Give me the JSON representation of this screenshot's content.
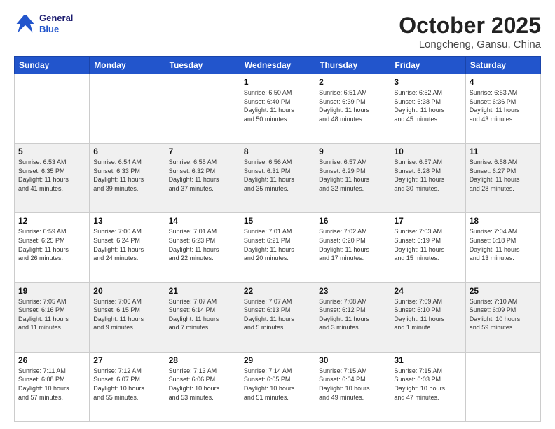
{
  "header": {
    "logo_line1": "General",
    "logo_line2": "Blue",
    "month": "October 2025",
    "location": "Longcheng, Gansu, China"
  },
  "days_of_week": [
    "Sunday",
    "Monday",
    "Tuesday",
    "Wednesday",
    "Thursday",
    "Friday",
    "Saturday"
  ],
  "weeks": [
    [
      {
        "num": "",
        "info": ""
      },
      {
        "num": "",
        "info": ""
      },
      {
        "num": "",
        "info": ""
      },
      {
        "num": "1",
        "info": "Sunrise: 6:50 AM\nSunset: 6:40 PM\nDaylight: 11 hours\nand 50 minutes."
      },
      {
        "num": "2",
        "info": "Sunrise: 6:51 AM\nSunset: 6:39 PM\nDaylight: 11 hours\nand 48 minutes."
      },
      {
        "num": "3",
        "info": "Sunrise: 6:52 AM\nSunset: 6:38 PM\nDaylight: 11 hours\nand 45 minutes."
      },
      {
        "num": "4",
        "info": "Sunrise: 6:53 AM\nSunset: 6:36 PM\nDaylight: 11 hours\nand 43 minutes."
      }
    ],
    [
      {
        "num": "5",
        "info": "Sunrise: 6:53 AM\nSunset: 6:35 PM\nDaylight: 11 hours\nand 41 minutes."
      },
      {
        "num": "6",
        "info": "Sunrise: 6:54 AM\nSunset: 6:33 PM\nDaylight: 11 hours\nand 39 minutes."
      },
      {
        "num": "7",
        "info": "Sunrise: 6:55 AM\nSunset: 6:32 PM\nDaylight: 11 hours\nand 37 minutes."
      },
      {
        "num": "8",
        "info": "Sunrise: 6:56 AM\nSunset: 6:31 PM\nDaylight: 11 hours\nand 35 minutes."
      },
      {
        "num": "9",
        "info": "Sunrise: 6:57 AM\nSunset: 6:29 PM\nDaylight: 11 hours\nand 32 minutes."
      },
      {
        "num": "10",
        "info": "Sunrise: 6:57 AM\nSunset: 6:28 PM\nDaylight: 11 hours\nand 30 minutes."
      },
      {
        "num": "11",
        "info": "Sunrise: 6:58 AM\nSunset: 6:27 PM\nDaylight: 11 hours\nand 28 minutes."
      }
    ],
    [
      {
        "num": "12",
        "info": "Sunrise: 6:59 AM\nSunset: 6:25 PM\nDaylight: 11 hours\nand 26 minutes."
      },
      {
        "num": "13",
        "info": "Sunrise: 7:00 AM\nSunset: 6:24 PM\nDaylight: 11 hours\nand 24 minutes."
      },
      {
        "num": "14",
        "info": "Sunrise: 7:01 AM\nSunset: 6:23 PM\nDaylight: 11 hours\nand 22 minutes."
      },
      {
        "num": "15",
        "info": "Sunrise: 7:01 AM\nSunset: 6:21 PM\nDaylight: 11 hours\nand 20 minutes."
      },
      {
        "num": "16",
        "info": "Sunrise: 7:02 AM\nSunset: 6:20 PM\nDaylight: 11 hours\nand 17 minutes."
      },
      {
        "num": "17",
        "info": "Sunrise: 7:03 AM\nSunset: 6:19 PM\nDaylight: 11 hours\nand 15 minutes."
      },
      {
        "num": "18",
        "info": "Sunrise: 7:04 AM\nSunset: 6:18 PM\nDaylight: 11 hours\nand 13 minutes."
      }
    ],
    [
      {
        "num": "19",
        "info": "Sunrise: 7:05 AM\nSunset: 6:16 PM\nDaylight: 11 hours\nand 11 minutes."
      },
      {
        "num": "20",
        "info": "Sunrise: 7:06 AM\nSunset: 6:15 PM\nDaylight: 11 hours\nand 9 minutes."
      },
      {
        "num": "21",
        "info": "Sunrise: 7:07 AM\nSunset: 6:14 PM\nDaylight: 11 hours\nand 7 minutes."
      },
      {
        "num": "22",
        "info": "Sunrise: 7:07 AM\nSunset: 6:13 PM\nDaylight: 11 hours\nand 5 minutes."
      },
      {
        "num": "23",
        "info": "Sunrise: 7:08 AM\nSunset: 6:12 PM\nDaylight: 11 hours\nand 3 minutes."
      },
      {
        "num": "24",
        "info": "Sunrise: 7:09 AM\nSunset: 6:10 PM\nDaylight: 11 hours\nand 1 minute."
      },
      {
        "num": "25",
        "info": "Sunrise: 7:10 AM\nSunset: 6:09 PM\nDaylight: 10 hours\nand 59 minutes."
      }
    ],
    [
      {
        "num": "26",
        "info": "Sunrise: 7:11 AM\nSunset: 6:08 PM\nDaylight: 10 hours\nand 57 minutes."
      },
      {
        "num": "27",
        "info": "Sunrise: 7:12 AM\nSunset: 6:07 PM\nDaylight: 10 hours\nand 55 minutes."
      },
      {
        "num": "28",
        "info": "Sunrise: 7:13 AM\nSunset: 6:06 PM\nDaylight: 10 hours\nand 53 minutes."
      },
      {
        "num": "29",
        "info": "Sunrise: 7:14 AM\nSunset: 6:05 PM\nDaylight: 10 hours\nand 51 minutes."
      },
      {
        "num": "30",
        "info": "Sunrise: 7:15 AM\nSunset: 6:04 PM\nDaylight: 10 hours\nand 49 minutes."
      },
      {
        "num": "31",
        "info": "Sunrise: 7:15 AM\nSunset: 6:03 PM\nDaylight: 10 hours\nand 47 minutes."
      },
      {
        "num": "",
        "info": ""
      }
    ]
  ]
}
